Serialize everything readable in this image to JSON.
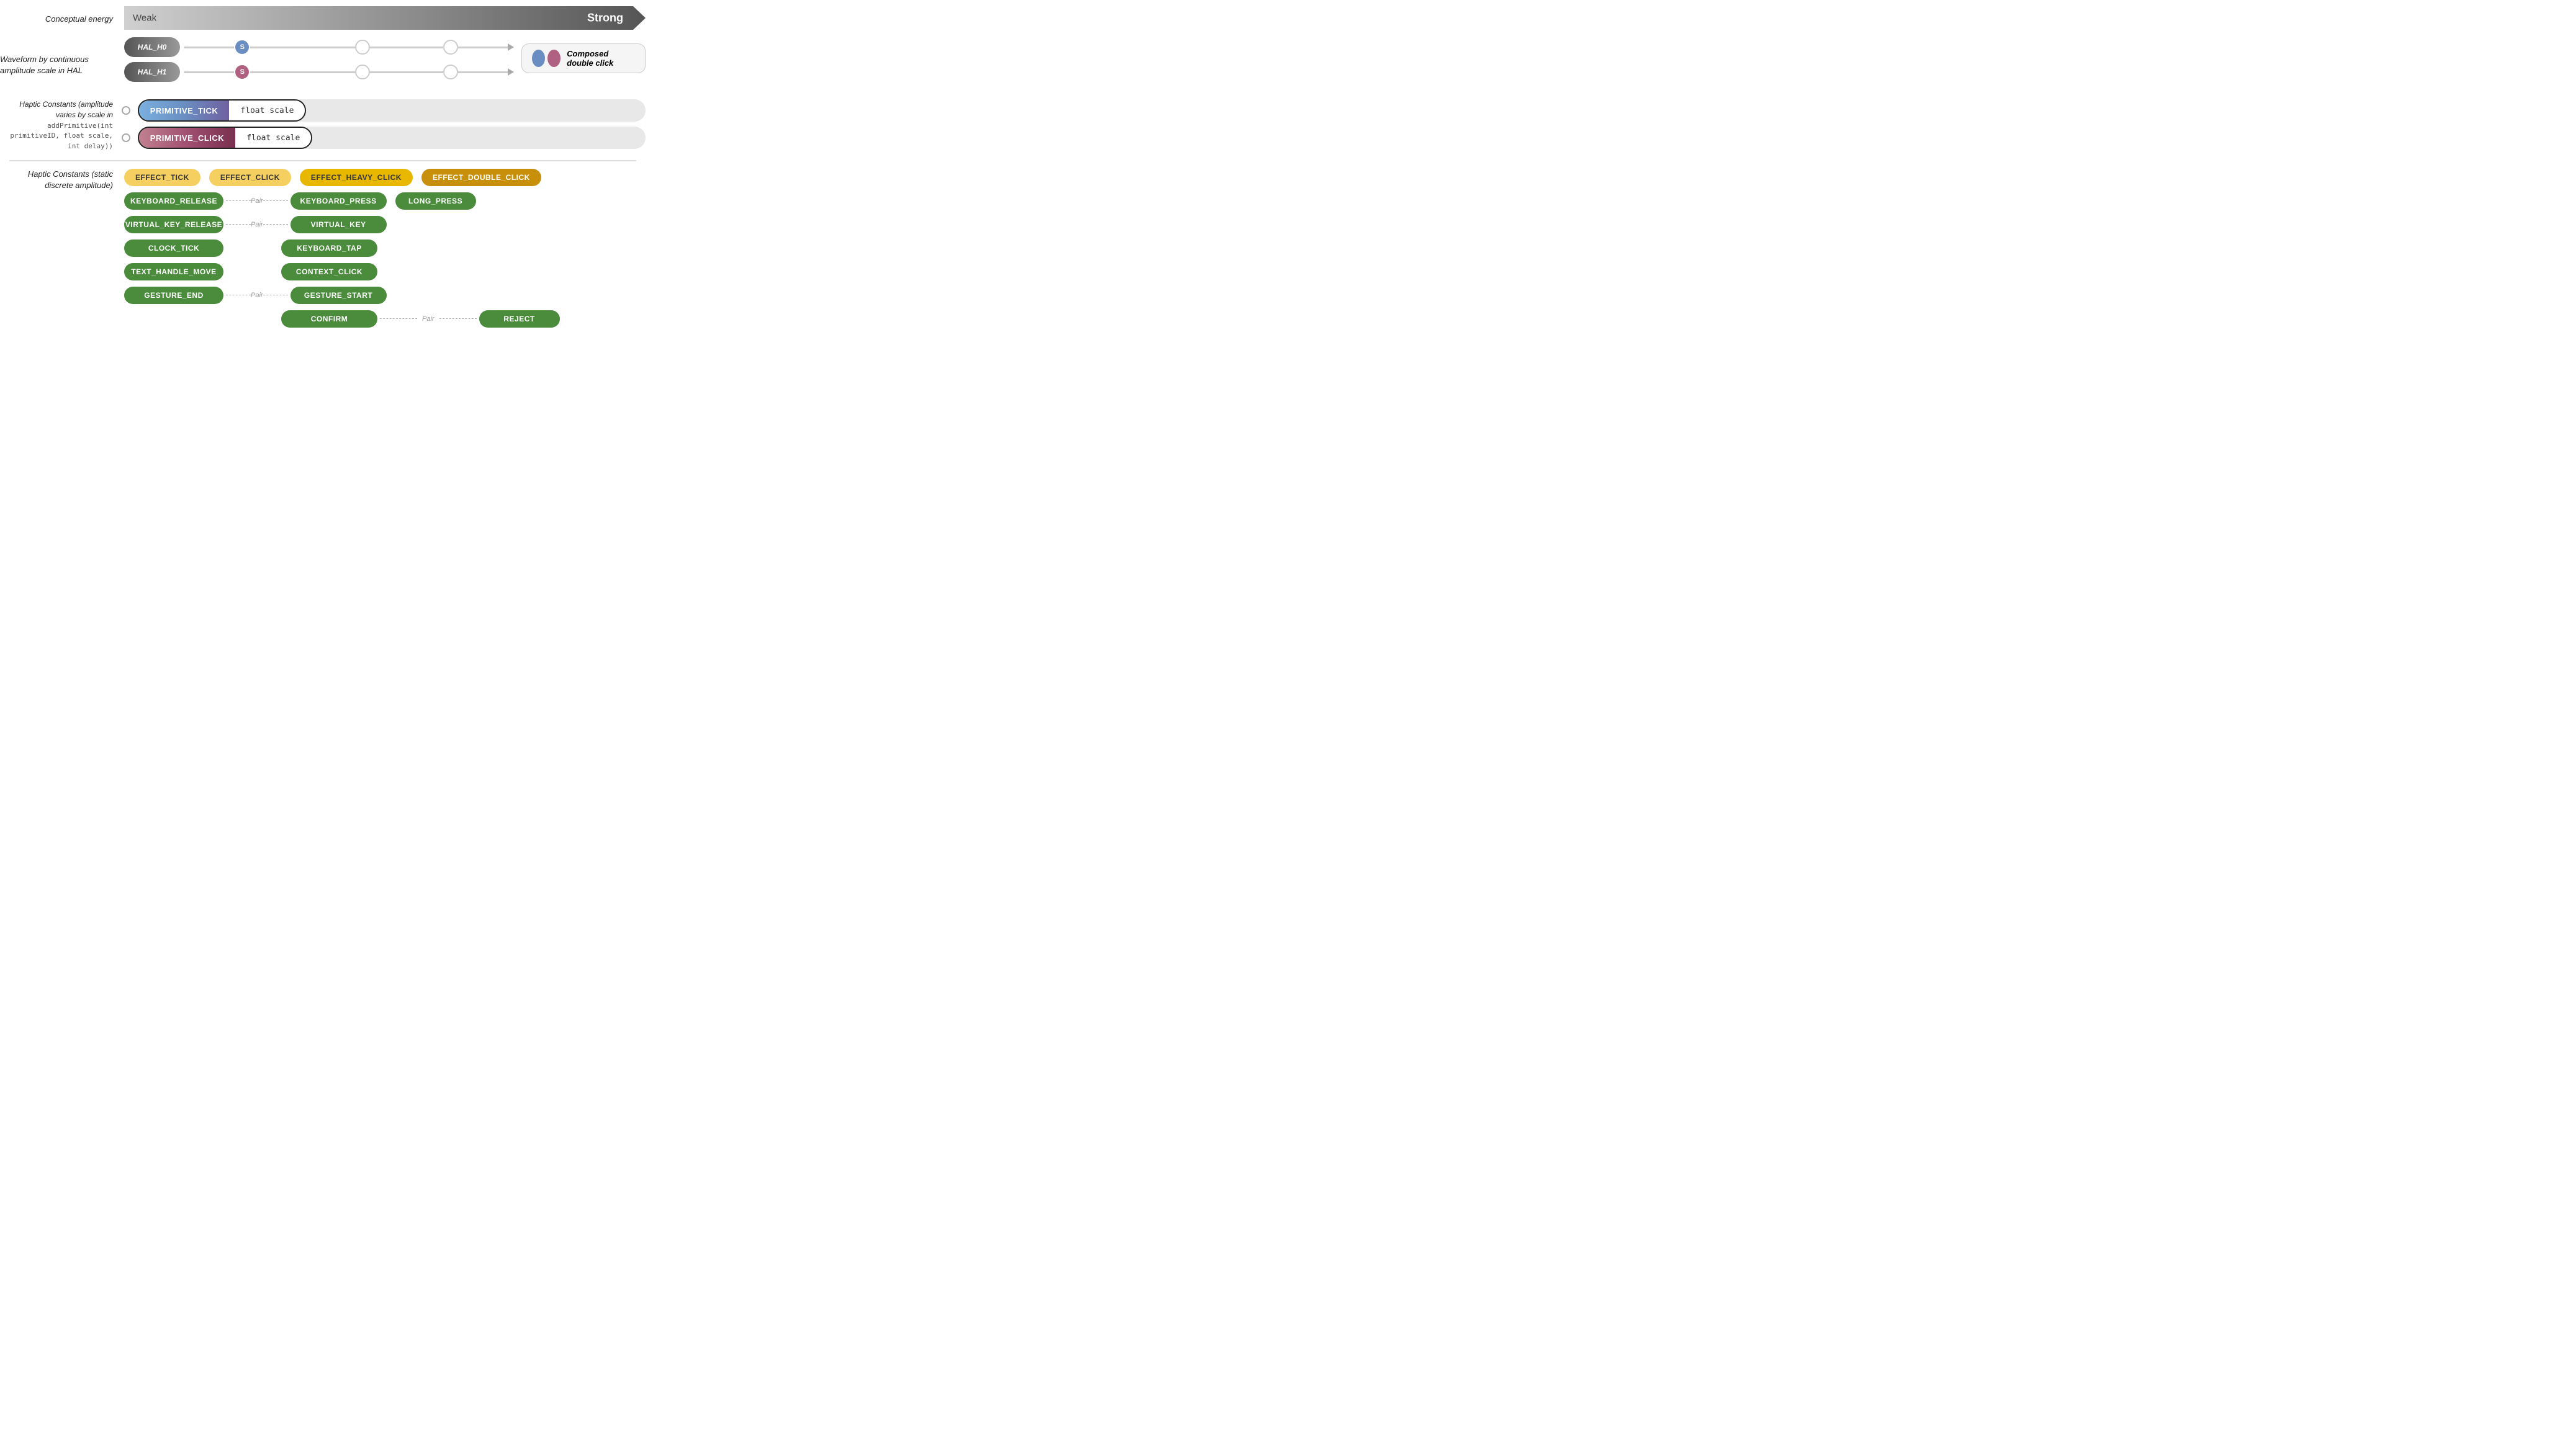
{
  "energy": {
    "label": "Conceptual energy",
    "weak": "Weak",
    "strong": "Strong"
  },
  "waveform": {
    "label": "Waveform by continuous amplitude scale in HAL",
    "hal0": {
      "id": "HAL_H0",
      "handle": "S"
    },
    "hal1": {
      "id": "HAL_H1",
      "handle": "S"
    },
    "composed_legend": "Composed double click"
  },
  "haptic_constants_continuous": {
    "label": "Haptic Constants (amplitude varies by scale in",
    "code": "addPrimitive(int primitiveID, float scale, int delay))",
    "pill1_left": "PRIMITIVE_TICK",
    "pill1_right": "float scale",
    "pill2_left": "PRIMITIVE_CLICK",
    "pill2_right": "float scale"
  },
  "haptic_constants_discrete": {
    "label": "Haptic Constants (static discrete amplitude)",
    "effects_top": [
      {
        "id": "effect-tick",
        "label": "EFFECT_TICK",
        "style": "yellow-light"
      },
      {
        "id": "effect-click",
        "label": "EFFECT_CLICK",
        "style": "yellow-light"
      },
      {
        "id": "effect-heavy-click",
        "label": "EFFECT_HEAVY_CLICK",
        "style": "yellow-mid"
      },
      {
        "id": "effect-double-click",
        "label": "EFFECT_DOUBLE_CLICK",
        "style": "yellow-dark"
      }
    ],
    "col1": [
      {
        "id": "keyboard-release",
        "label": "KEYBOARD_RELEASE",
        "style": "green"
      },
      {
        "id": "virtual-key-release",
        "label": "VIRTUAL_KEY_RELEASE",
        "style": "green"
      },
      {
        "id": "clock-tick",
        "label": "CLOCK_TICK",
        "style": "green"
      },
      {
        "id": "text-handle-move",
        "label": "TEXT_HANDLE_MOVE",
        "style": "green"
      },
      {
        "id": "gesture-end",
        "label": "GESTURE_END",
        "style": "green"
      }
    ],
    "col2": [
      {
        "id": "keyboard-press",
        "label": "KEYBOARD_PRESS",
        "style": "green"
      },
      {
        "id": "virtual-key",
        "label": "VIRTUAL_KEY",
        "style": "green"
      },
      {
        "id": "keyboard-tap",
        "label": "KEYBOARD_TAP",
        "style": "green"
      },
      {
        "id": "context-click",
        "label": "CONTEXT_CLICK",
        "style": "green"
      },
      {
        "id": "gesture-start",
        "label": "GESTURE_START",
        "style": "green"
      },
      {
        "id": "confirm",
        "label": "CONFIRM",
        "style": "green"
      }
    ],
    "col3": [
      {
        "id": "long-press",
        "label": "LONG_PRESS",
        "style": "green"
      }
    ],
    "col4": [
      {
        "id": "reject",
        "label": "REJECT",
        "style": "green"
      }
    ],
    "pair_labels": {
      "pair1": "Pair",
      "pair2": "Pair",
      "pair3": "Pair",
      "pair4": "Pair"
    }
  }
}
